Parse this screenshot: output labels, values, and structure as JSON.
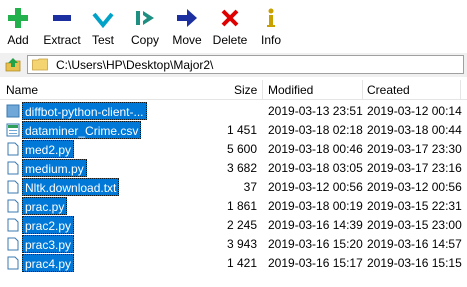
{
  "toolbar": {
    "add": "Add",
    "extract": "Extract",
    "test": "Test",
    "copy": "Copy",
    "move": "Move",
    "delete": "Delete",
    "info": "Info"
  },
  "address": {
    "path": "C:\\Users\\HP\\Desktop\\Major2\\"
  },
  "columns": {
    "name": "Name",
    "size": "Size",
    "modified": "Modified",
    "created": "Created"
  },
  "files": [
    {
      "name": "diffbot-python-client-...",
      "size": "",
      "modified": "2019-03-13 23:51",
      "created": "2019-03-12 00:14",
      "icon": "folder-icon"
    },
    {
      "name": "dataminer_Crime.csv",
      "size": "1 451",
      "modified": "2019-03-18 02:18",
      "created": "2019-03-18 00:44",
      "icon": "csv-file-icon"
    },
    {
      "name": "med2.py",
      "size": "5 600",
      "modified": "2019-03-18 00:46",
      "created": "2019-03-17 23:30",
      "icon": "file-icon"
    },
    {
      "name": "medium.py",
      "size": "3 682",
      "modified": "2019-03-18 03:05",
      "created": "2019-03-17 23:16",
      "icon": "file-icon"
    },
    {
      "name": "Nltk.download.txt",
      "size": "37",
      "modified": "2019-03-12 00:56",
      "created": "2019-03-12 00:56",
      "icon": "file-icon"
    },
    {
      "name": "prac.py",
      "size": "1 861",
      "modified": "2019-03-18 00:19",
      "created": "2019-03-15 22:31",
      "icon": "file-icon"
    },
    {
      "name": "prac2.py",
      "size": "2 245",
      "modified": "2019-03-16 14:39",
      "created": "2019-03-15 23:00",
      "icon": "file-icon"
    },
    {
      "name": "prac3.py",
      "size": "3 943",
      "modified": "2019-03-16 15:20",
      "created": "2019-03-16 14:57",
      "icon": "file-icon"
    },
    {
      "name": "prac4.py",
      "size": "1 421",
      "modified": "2019-03-16 15:17",
      "created": "2019-03-16 15:15",
      "icon": "file-icon"
    }
  ],
  "colors": {
    "selection": "#0078d7",
    "add_icon": "#22b14c",
    "extract_icon": "#1c2fa0",
    "test_icon": "#00a2c8",
    "copy_icon": "#1e8f80",
    "move_icon": "#1c2fa0",
    "delete_icon": "#e00000",
    "info_icon": "#c8a000"
  }
}
